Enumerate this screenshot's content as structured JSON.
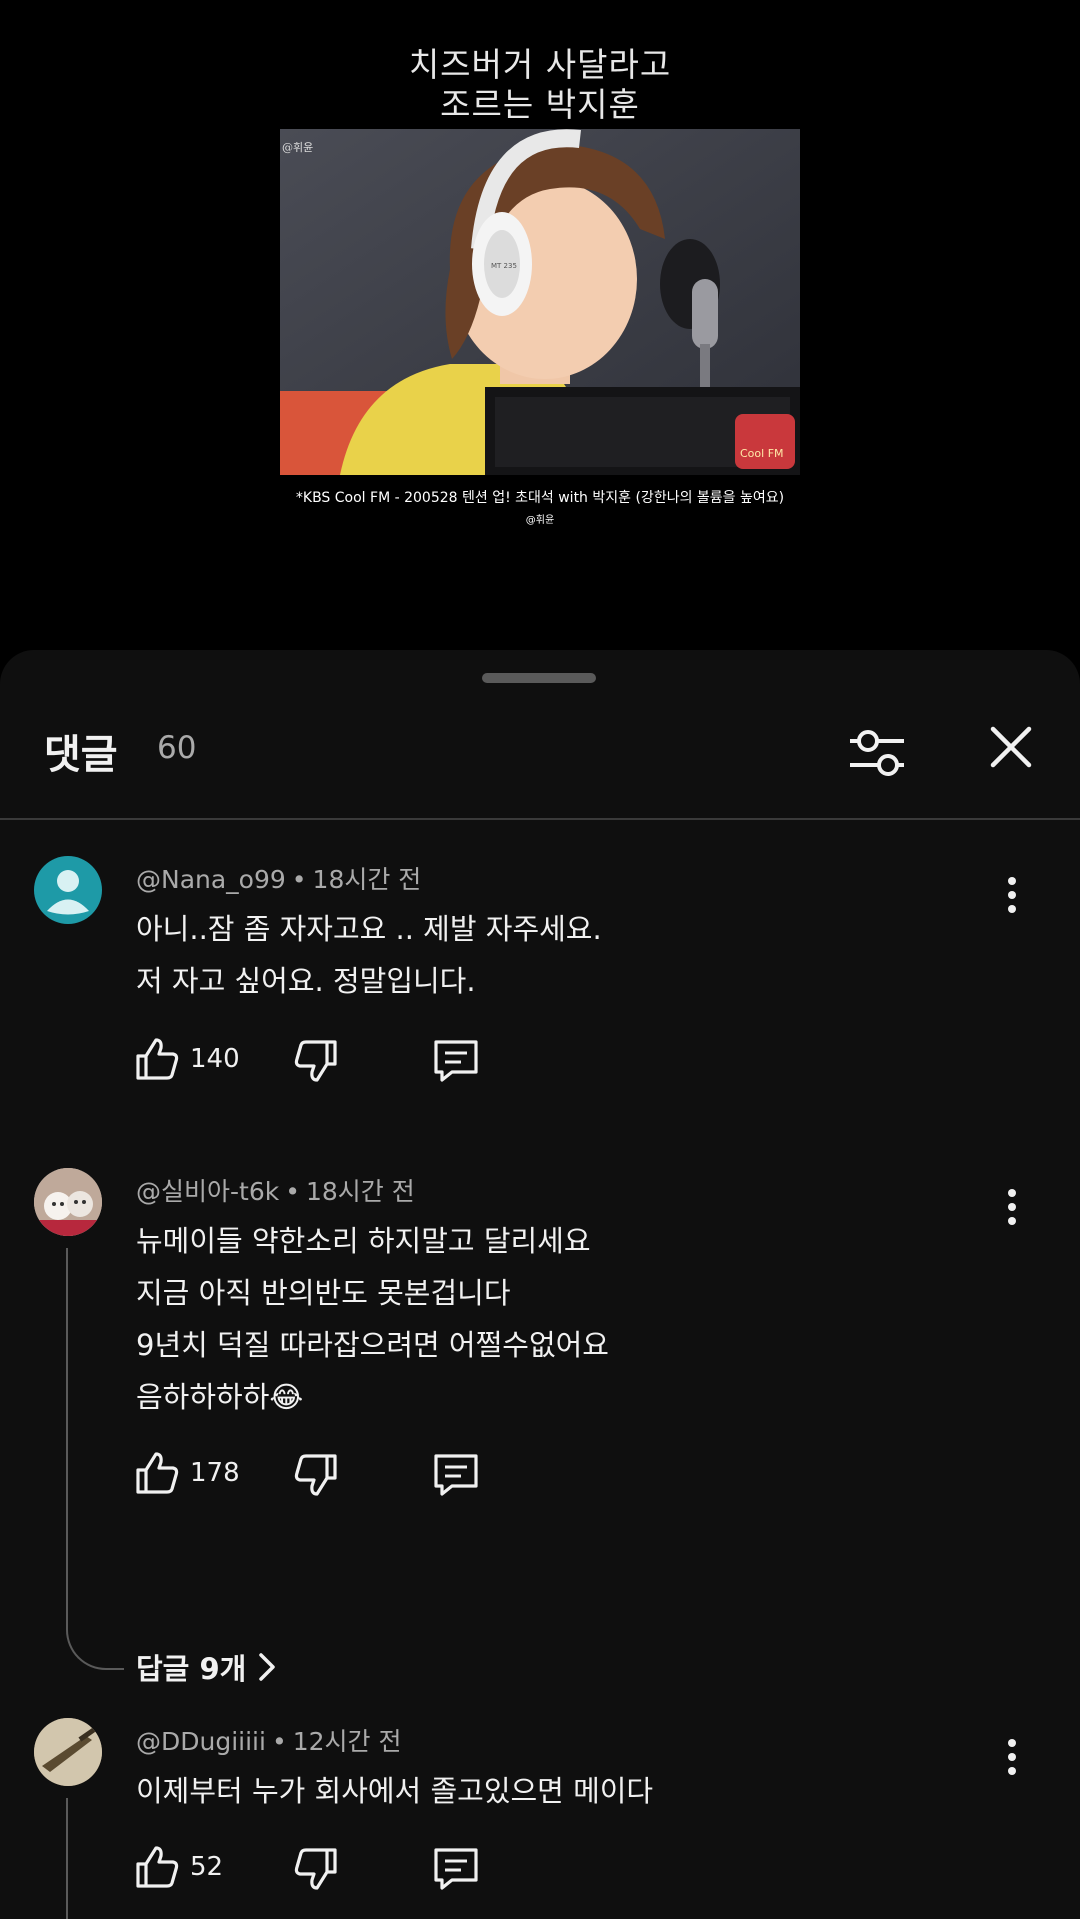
{
  "video": {
    "caption_line1": "치즈버거 사달라고",
    "caption_line2": "조르는 박지훈",
    "frame_watermark": "@휘윤",
    "headphone_text": "MT 235",
    "source_credit": "*KBS Cool FM - 200528 텐션 업! 초대석 with 박지훈 (강한나의 볼륨을 높여요)",
    "credit_handle": "@휘윤",
    "logo_text": "Cool FM"
  },
  "sheet": {
    "title": "댓글",
    "count": "60",
    "filter_icon": "sliders-icon",
    "close_icon": "close-icon"
  },
  "comments": [
    {
      "author": "@Nana_o99",
      "time": "18시간 전",
      "lines": [
        "아니..잠 좀 자자고요 .. 제발 자주세요.",
        "저 자고 싶어요. 정말입니다."
      ],
      "likes": "140",
      "avatar_color": "#1e9aa7"
    },
    {
      "author": "@실비아-t6k",
      "time": "18시간 전",
      "lines": [
        "뉴메이들 약한소리 하지말고 달리세요",
        "지금 아직 반의반도  못본겁니다",
        "9년치 덕질 따라잡으려면 어쩔수없어요",
        "음하하하하😂"
      ],
      "likes": "178",
      "replies": "답글 9개"
    },
    {
      "author": "@DDugiiiii",
      "time": "12시간 전",
      "lines": [
        "이제부터 누가 회사에서 졸고있으면 메이다"
      ],
      "likes": "52"
    }
  ],
  "colors": {
    "sheet_bg": "#0f0f0f",
    "text_primary": "#f1f1f1",
    "text_secondary": "#aaaaaa"
  }
}
